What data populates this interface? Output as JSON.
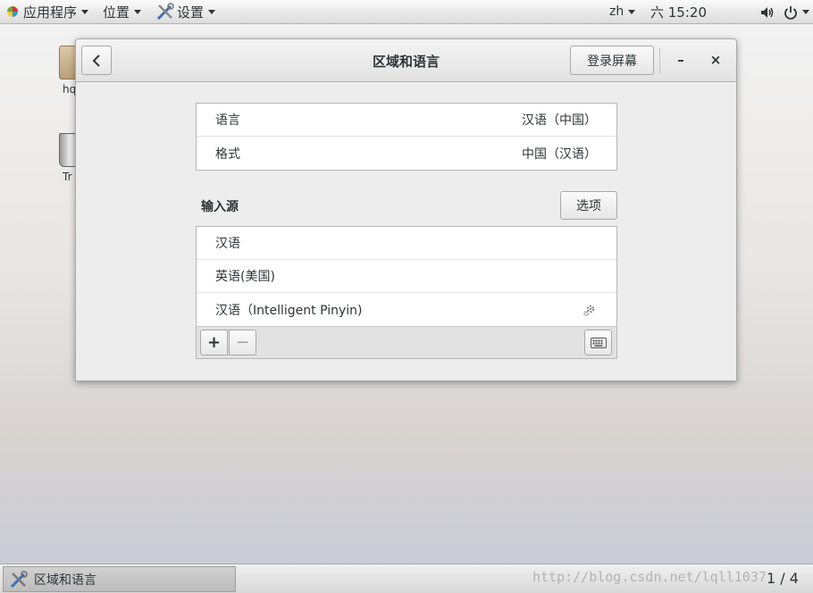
{
  "topbar": {
    "apps_label": "应用程序",
    "places_label": "位置",
    "settings_label": "设置",
    "input_method": "zh",
    "clock": "六 15:20"
  },
  "desktop": {
    "icons": [
      {
        "label": "hq",
        "icon": "folder-icon"
      },
      {
        "label": "Tr",
        "icon": "trash-icon"
      }
    ]
  },
  "dialog": {
    "title": "区域和语言",
    "login_screen_button": "登录屏幕",
    "minimize": "–",
    "close": "×",
    "settings_rows": [
      {
        "label": "语言",
        "value": "汉语（中国）"
      },
      {
        "label": "格式",
        "value": "中国（汉语）"
      }
    ],
    "input_sources_heading": "输入源",
    "options_button": "选项",
    "input_sources": [
      {
        "label": "汉语"
      },
      {
        "label": "英语(美国)"
      },
      {
        "label": "汉语（Intelligent Pinyin)"
      }
    ],
    "add_label": "+",
    "remove_label": "−"
  },
  "bottombar": {
    "task_label": "区域和语言",
    "watermark": "http://blog.csdn.net/lqll1037",
    "workspace": "1 / 4"
  }
}
